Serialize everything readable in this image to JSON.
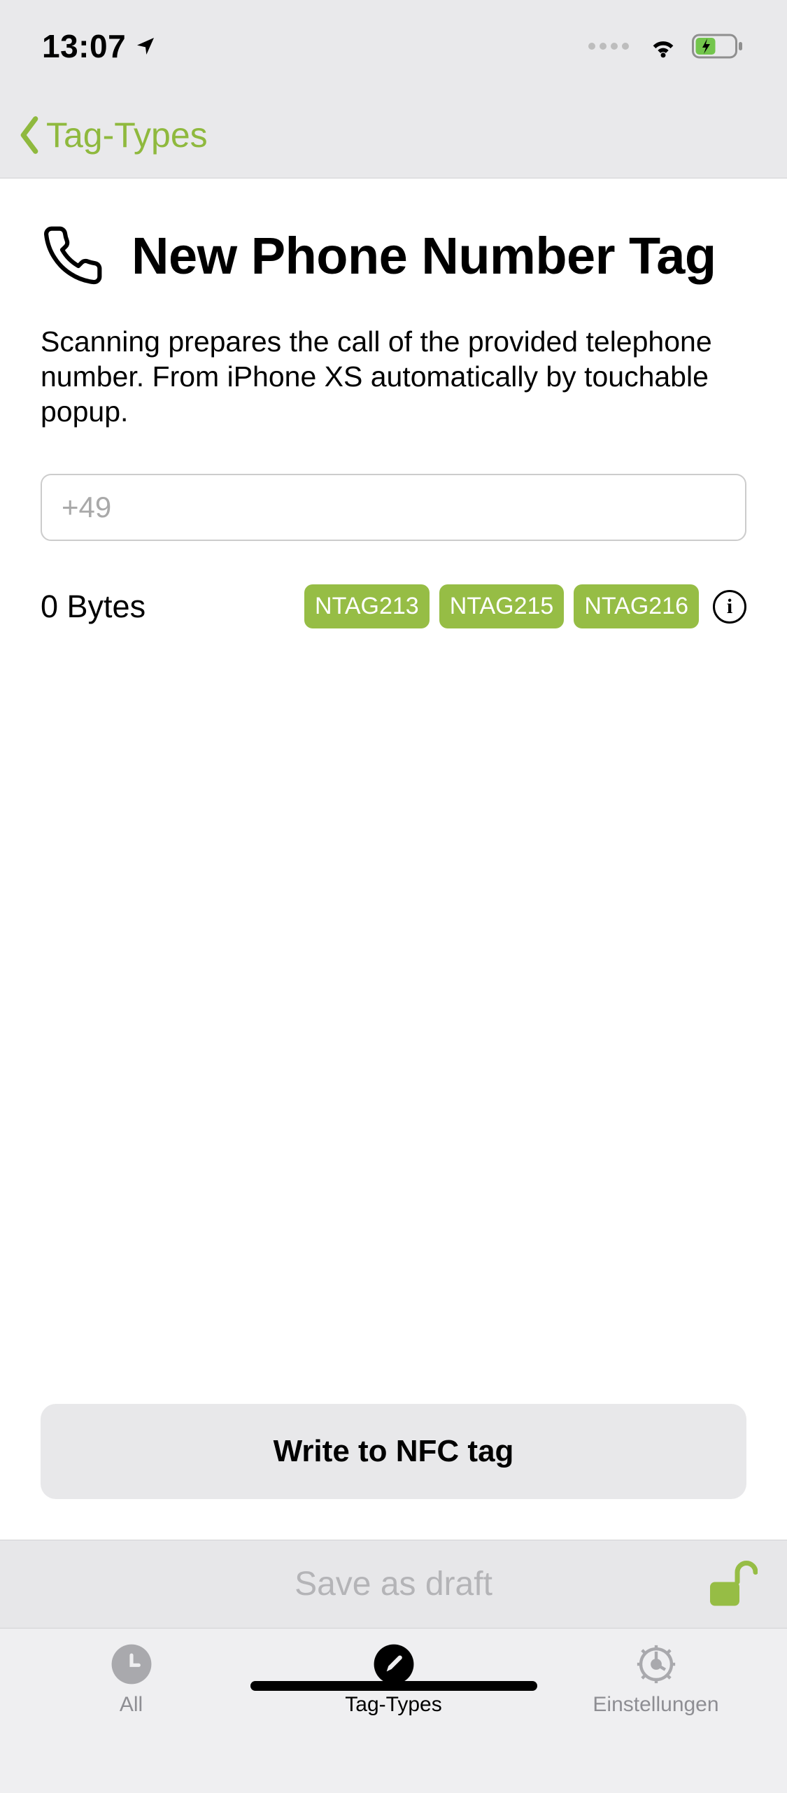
{
  "statusbar": {
    "time": "13:07"
  },
  "nav": {
    "back_label": "Tag-Types"
  },
  "page": {
    "title": "New Phone Number Tag",
    "description": "Scanning prepares the call of the provided telephone number. From iPhone XS automatically by touchable popup.",
    "phone_placeholder": "+49",
    "bytes_label": "0 Bytes",
    "tags": [
      "NTAG213",
      "NTAG215",
      "NTAG216"
    ],
    "write_button": "Write to NFC tag"
  },
  "savebar": {
    "label": "Save as draft"
  },
  "tabs": {
    "all": "All",
    "tagtypes": "Tag-Types",
    "settings": "Einstellungen"
  },
  "colors": {
    "accent": "#8FB93E",
    "chip": "#96BD45"
  }
}
